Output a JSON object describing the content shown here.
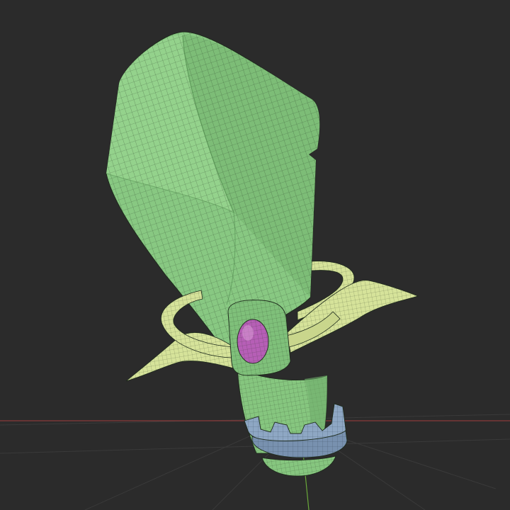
{
  "viewport": {
    "background": "#2b2b2b",
    "floor_grid_color": "#3a3a3a",
    "x_axis_color": "#8a3a3a",
    "y_axis_color": "#6aa83a"
  },
  "model": {
    "blade_color": "#88c882",
    "blade_shade_color": "#6fae6b",
    "blade_highlight_color": "#a3dd9b",
    "guard_color": "#d6e39a",
    "guard_shade_color": "#bccb80",
    "gem_socket_color": "#7fc07a",
    "gem_color": "#b65fb6",
    "gem_highlight_color": "#d99ad6",
    "grip_color": "#86c67f",
    "pommel_ring_color": "#8ea7c4",
    "pommel_ring_shade_color": "#6f88a6",
    "pommel_color": "#86c67f",
    "wireframe_color": "#1d2a1b"
  }
}
